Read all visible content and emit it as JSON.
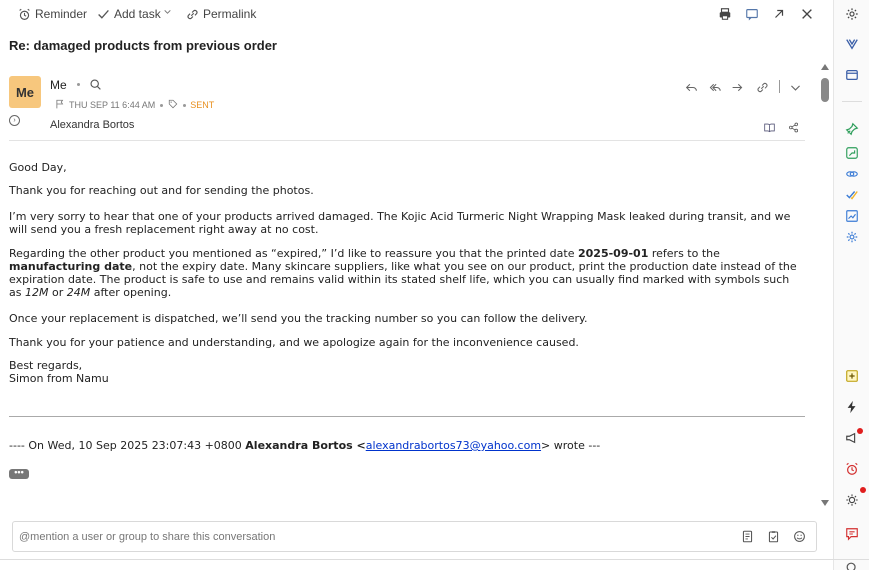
{
  "toolbar": {
    "reminder": "Reminder",
    "add_task": "Add task",
    "permalink": "Permalink"
  },
  "subject": "Re: damaged products from previous order",
  "message": {
    "avatar_initials": "Me",
    "from": "Me",
    "date": "THU SEP 11 6:44 AM",
    "status": "SENT",
    "to": "Alexandra Bortos"
  },
  "body": {
    "greeting": "Good Day,",
    "p1": "Thank you for reaching out and for sending the photos.",
    "p2": "I’m very sorry to hear that one of your products arrived damaged. The Kojic Acid Turmeric Night Wrapping Mask leaked during transit, and we will send you a fresh replacement right away at no cost.",
    "p3_a": "Regarding the other product you mentioned as “expired,” I’d like to reassure you that the printed date ",
    "p3_date": "2025-09-01",
    "p3_b": " refers to the ",
    "p3_mfg": "manufacturing date",
    "p3_c": ", not the expiry date. Many skincare suppliers, like what you see on our product, print the production date instead of the expiration date. The product is safe to use and remains valid within its stated shelf life, which you can usually find marked with symbols such as ",
    "p3_12m": "12M",
    "p3_or": " or ",
    "p3_24m": "24M",
    "p3_d": " after opening.",
    "p4": "Once your replacement is dispatched, we’ll send you the tracking number so you can follow the delivery.",
    "p5": "Thank you for your patience and understanding, and we apologize again for the inconvenience caused.",
    "signoff": "Best regards,",
    "signature": "Simon from Namu"
  },
  "quote": {
    "prefix": "---- On Wed, 10 Sep 2025 23:07:43 +0800 ",
    "name": "Alexandra Bortos",
    "open": " <",
    "email": "alexandrabortos73@yahoo.com",
    "suffix": "> wrote ---",
    "ellipsis": "•••"
  },
  "comment": {
    "placeholder": "@mention a user or group to share this conversation"
  },
  "colors": {
    "sent_status": "#e8901f",
    "avatar_bg": "#f7c77d",
    "link": "#0033cc",
    "right_panel_green": "#2e9e5b",
    "right_panel_blue": "#3a7bd5",
    "notification_dot": "#e01e1e"
  }
}
